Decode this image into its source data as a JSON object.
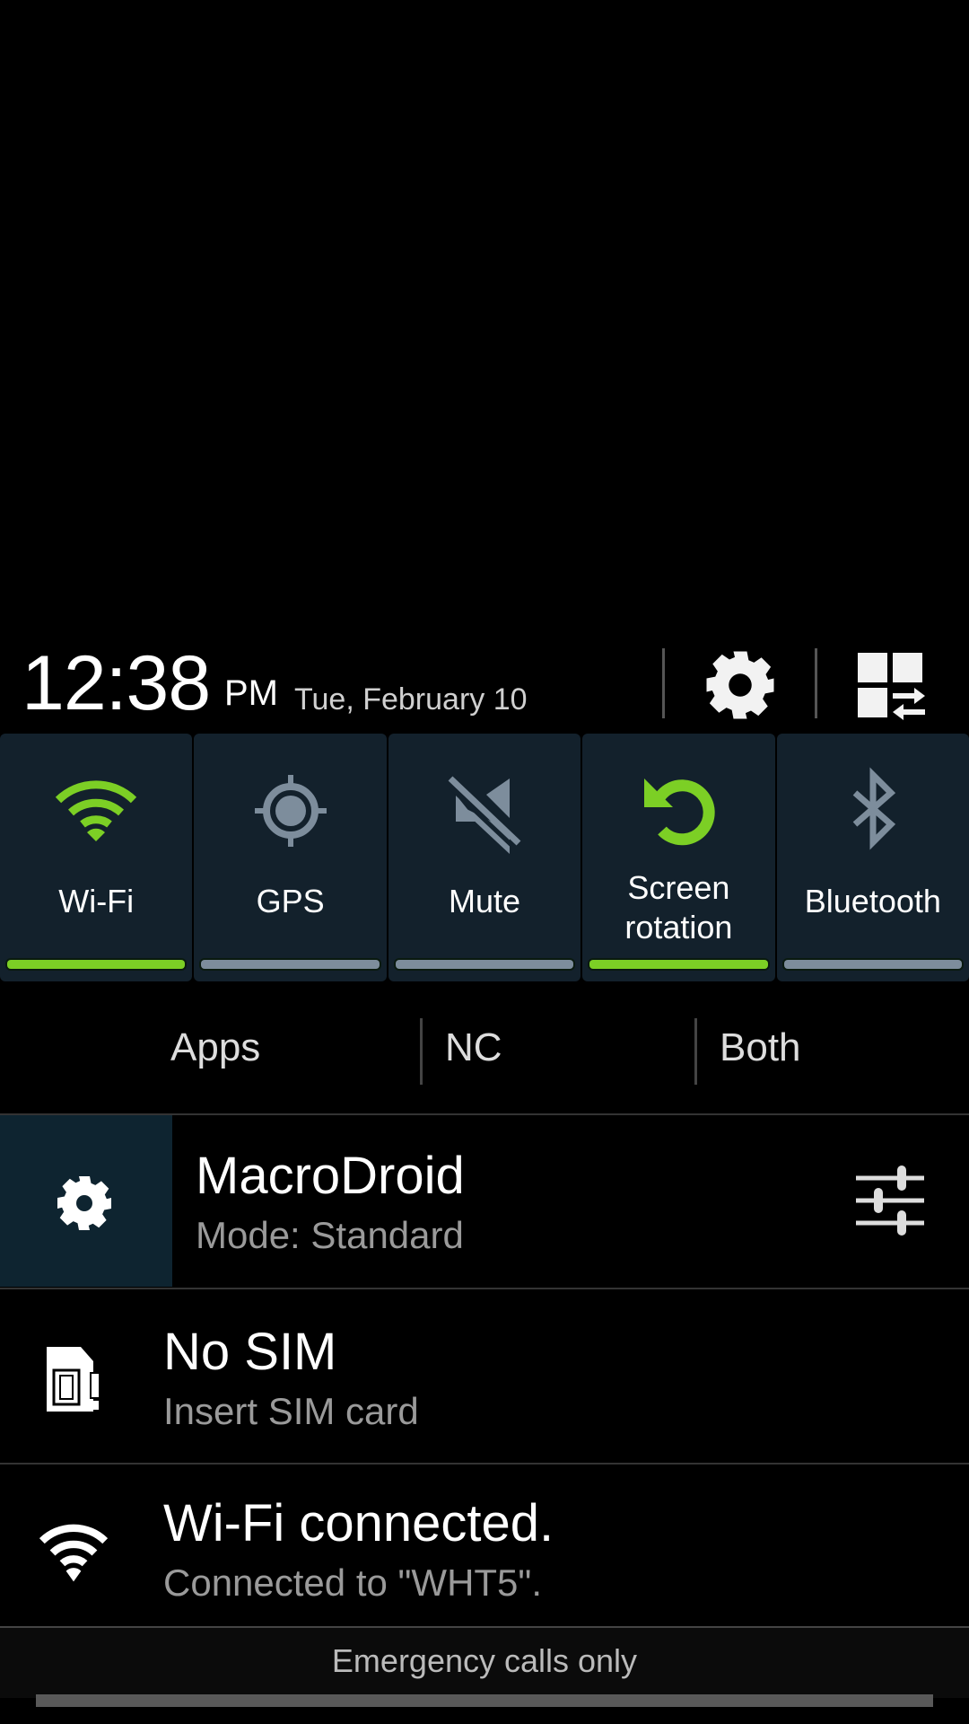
{
  "header": {
    "time": "12:38",
    "ampm": "PM",
    "date": "Tue, February 10",
    "icons": [
      "settings-gear-icon",
      "edit-quick-settings-grid-icon"
    ]
  },
  "quick_settings": [
    {
      "label": "Wi-Fi",
      "icon": "wifi-icon",
      "enabled": true
    },
    {
      "label": "GPS",
      "icon": "gps-icon",
      "enabled": false
    },
    {
      "label": "Mute",
      "icon": "mute-icon",
      "enabled": false
    },
    {
      "label": "Screen rotation",
      "label_line1": "Screen",
      "label_line2": "rotation",
      "icon": "screen-rotation-icon",
      "enabled": true
    },
    {
      "label": "Bluetooth",
      "icon": "bluetooth-icon",
      "enabled": false
    }
  ],
  "tabs": [
    {
      "label": "Apps"
    },
    {
      "label": "NC"
    },
    {
      "label": "Both"
    }
  ],
  "notifications": [
    {
      "title": "MacroDroid",
      "subtitle": "Mode: Standard",
      "icon": "gear-icon",
      "action_icon": "tune-sliders-icon"
    },
    {
      "title": "No SIM",
      "subtitle": "Insert SIM card",
      "icon": "sim-card-alert-icon"
    },
    {
      "title": "Wi-Fi connected.",
      "subtitle": "Connected to \"WHT5\".",
      "icon": "wifi-icon"
    }
  ],
  "footer": {
    "carrier_text": "Emergency calls only"
  },
  "colors": {
    "accent_on": "#7ccf25",
    "accent_off": "#7d8d9c",
    "tile_bg": "#13212c"
  }
}
